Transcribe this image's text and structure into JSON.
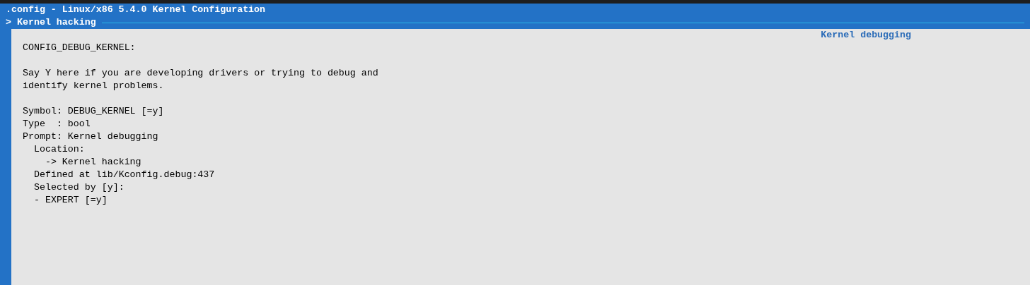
{
  "window": {
    "title": ".config - Linux/x86 5.4.0 Kernel Configuration"
  },
  "breadcrumb": {
    "marker": ">",
    "label": "Kernel hacking"
  },
  "help_panel": {
    "title": "Kernel debugging",
    "paragraphs": [
      [
        "CONFIG_DEBUG_KERNEL:"
      ],
      [
        "Say Y here if you are developing drivers or trying to debug and",
        "identify kernel problems."
      ],
      [
        "Symbol: DEBUG_KERNEL [=y]",
        "Type  : bool",
        "Prompt: Kernel debugging",
        "  Location:",
        "    -> Kernel hacking",
        "  Defined at lib/Kconfig.debug:437",
        "  Selected by [y]:",
        "  - EXPERT [=y]"
      ]
    ]
  }
}
